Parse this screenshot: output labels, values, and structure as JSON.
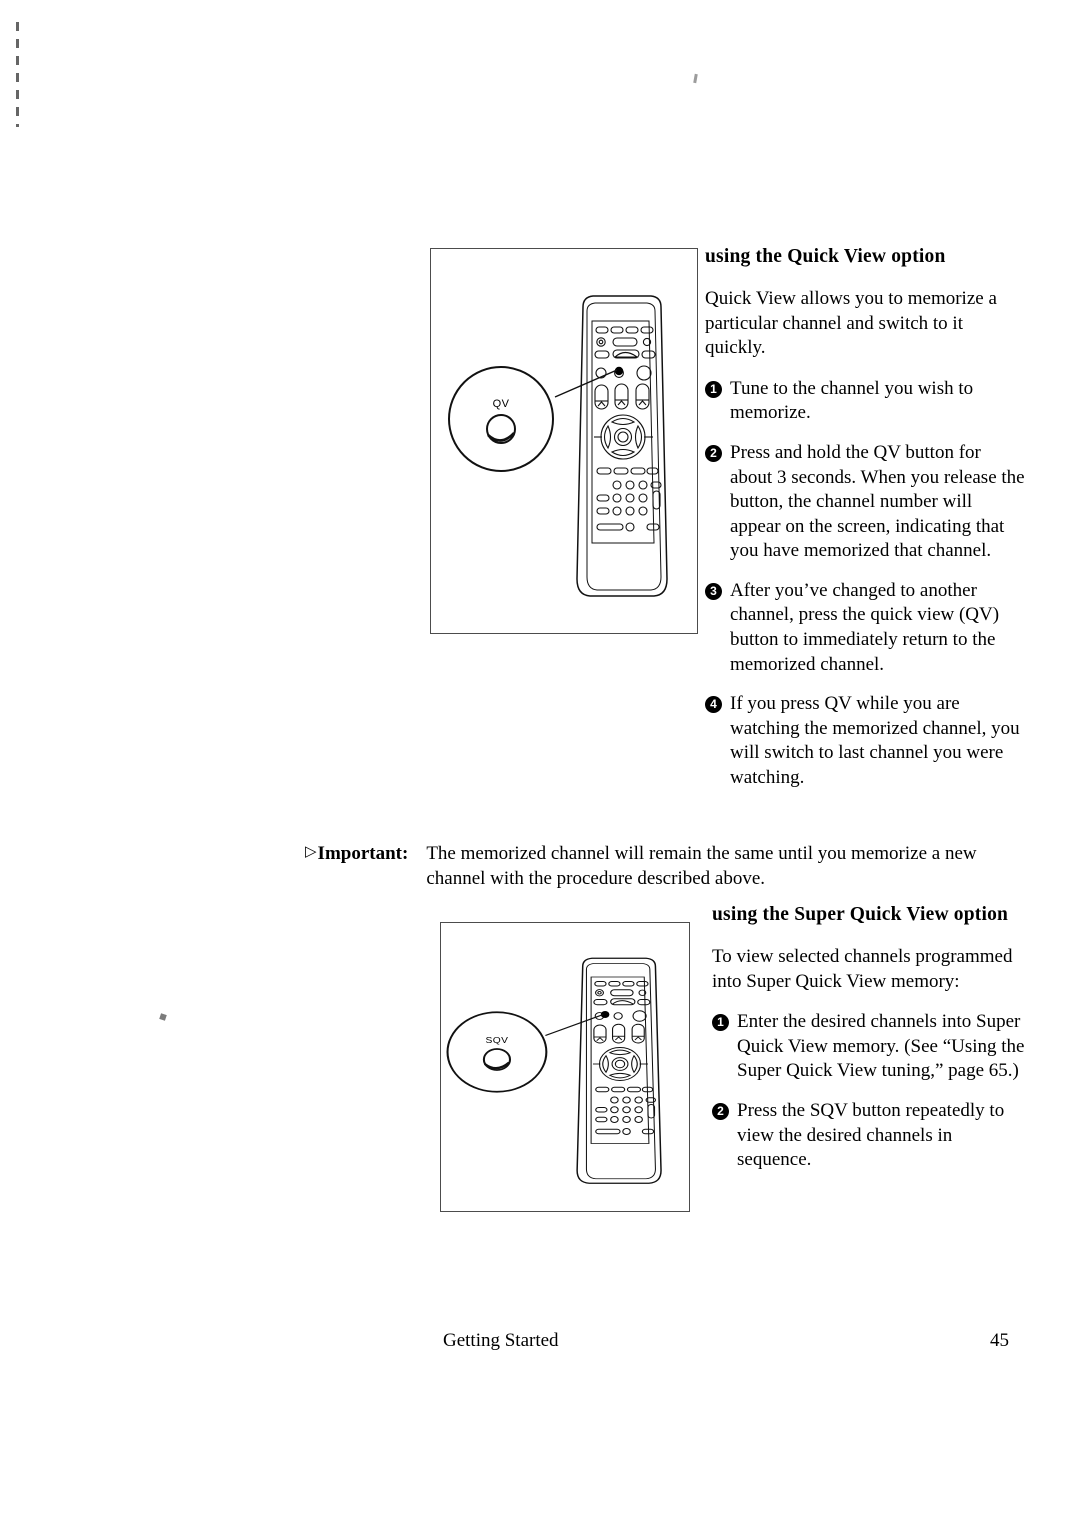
{
  "page": {
    "footer_left": "Getting Started",
    "footer_page_number": "45"
  },
  "quick_view": {
    "heading": "using the Quick View option",
    "intro": "Quick View allows you to memorize a particular channel and switch to it quickly.",
    "steps": [
      {
        "number": "1",
        "text": "Tune to the channel you wish to memorize."
      },
      {
        "number": "2",
        "text": "Press and hold the QV button for about 3 seconds. When you release the button, the channel number will appear on the screen, indicating that you have memorized that channel."
      },
      {
        "number": "3",
        "text": "After you’ve changed to another channel, press the quick view (QV) button to immediately return to the memorized channel."
      },
      {
        "number": "4",
        "text": "If you press QV while you are watching the memorized channel, you will switch to last channel you were watching."
      }
    ],
    "figure": {
      "callout_label": "QV",
      "alt": "Remote control with the QV button highlighted and magnified in a circular callout"
    }
  },
  "important_note": {
    "marker": "▷",
    "label": "Important:",
    "text": "The memorized channel will remain the same until you memorize a new channel with the procedure described above."
  },
  "super_quick_view": {
    "heading": "using the Super Quick View option",
    "intro": "To view selected channels programmed into Super Quick View memory:",
    "steps": [
      {
        "number": "1",
        "text": "Enter the desired channels into Super Quick View memory. (See “Using the Super Quick View tuning,” page 65.)"
      },
      {
        "number": "2",
        "text": "Press the SQV button repeatedly to view the desired channels in sequence."
      }
    ],
    "figure": {
      "callout_label": "SQV",
      "alt": "Remote control with the SQV button highlighted and magnified in a circular callout"
    }
  }
}
